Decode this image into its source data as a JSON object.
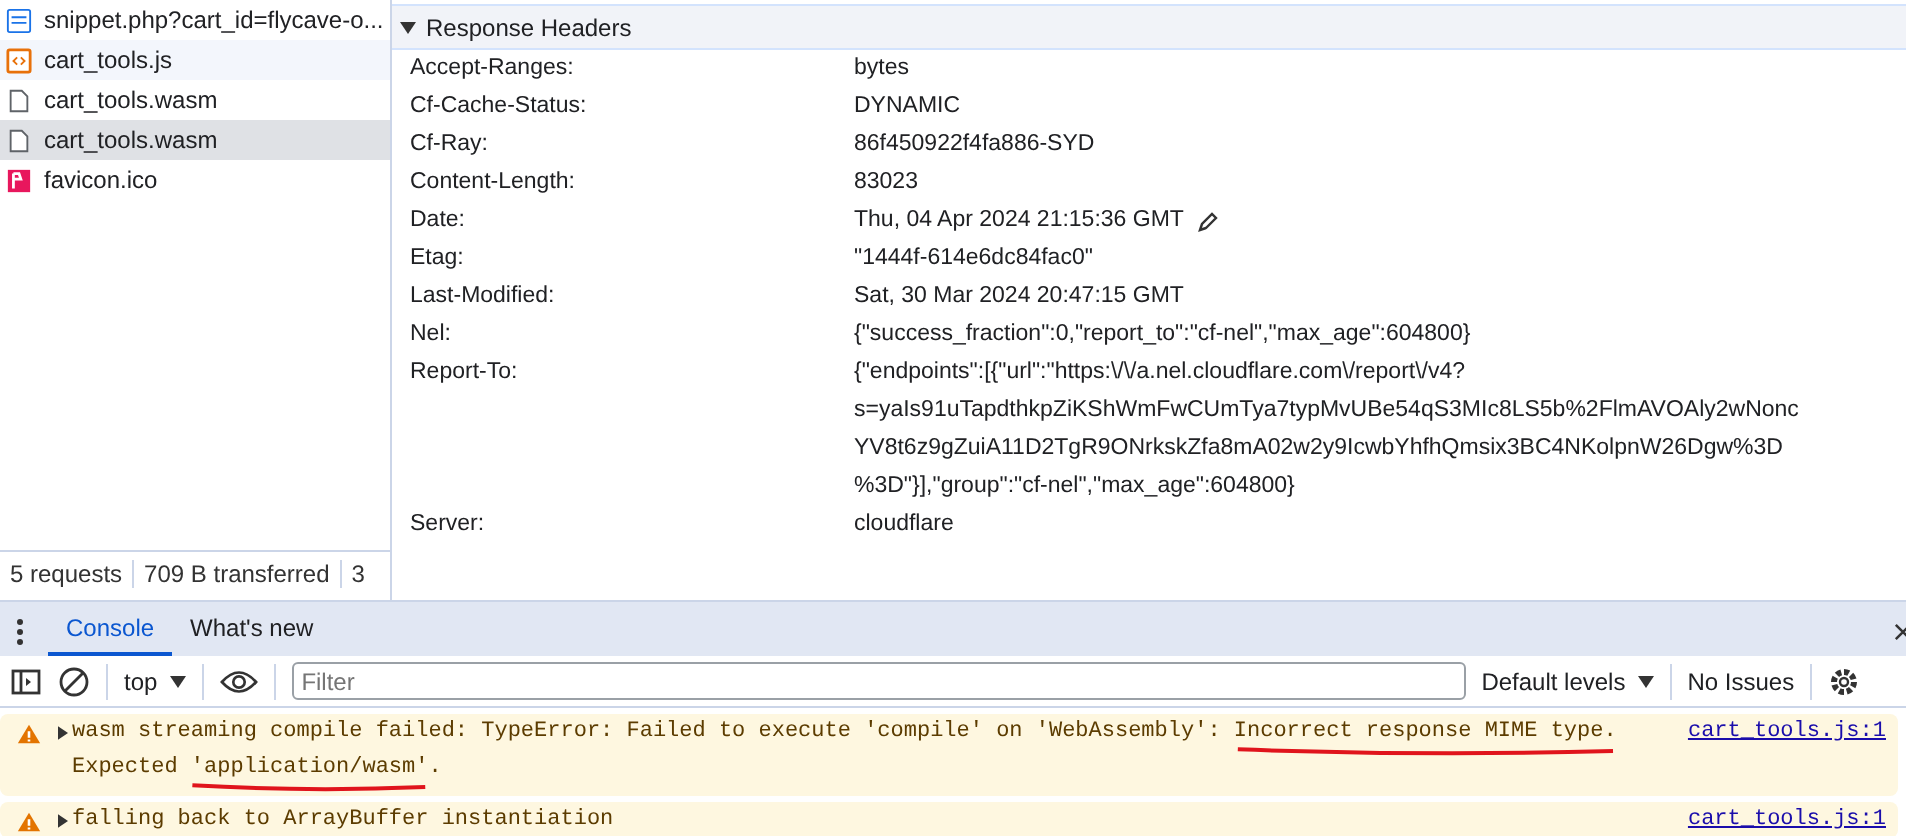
{
  "requests": [
    {
      "name": "snippet.php?cart_id=flycave-o...",
      "kind": "doc",
      "selected": false
    },
    {
      "name": "cart_tools.js",
      "kind": "script",
      "selected": false
    },
    {
      "name": "cart_tools.wasm",
      "kind": "file",
      "selected": false
    },
    {
      "name": "cart_tools.wasm",
      "kind": "file",
      "selected": true
    },
    {
      "name": "favicon.ico",
      "kind": "image",
      "selected": false
    }
  ],
  "status_bar": [
    "5 requests",
    "709 B transferred",
    "3"
  ],
  "response_headers": {
    "title": "Response Headers",
    "expanded": true,
    "rows": [
      {
        "name": "Accept-Ranges:",
        "value": "bytes"
      },
      {
        "name": "Cf-Cache-Status:",
        "value": "DYNAMIC"
      },
      {
        "name": "Cf-Ray:",
        "value": "86f450922f4fa886-SYD"
      },
      {
        "name": "Content-Length:",
        "value": "83023"
      },
      {
        "name": "Date:",
        "value": "Thu, 04 Apr 2024 21:15:36 GMT",
        "editable": true
      },
      {
        "name": "Etag:",
        "value": "\"1444f-614e6dc84fac0\""
      },
      {
        "name": "Last-Modified:",
        "value": "Sat, 30 Mar 2024 20:47:15 GMT"
      },
      {
        "name": "Nel:",
        "value": "{\"success_fraction\":0,\"report_to\":\"cf-nel\",\"max_age\":604800}"
      },
      {
        "name": "Report-To:",
        "value": "{\"endpoints\":[{\"url\":\"https:\\/\\/a.nel.cloudflare.com\\/report\\/v4?\ns=yaIs91uTapdthkpZiKShWmFwCUmTya7typMvUBe54qS3MIc8LS5b%2FlmAVOAly2wNonc\nYV8t6z9gZuiA11D2TgR9ONrkskZfa8mA02w2y9IcwbYhfhQmsix3BC4NKolpnW26Dgw%3D\n%3D\"}],\"group\":\"cf-nel\",\"max_age\":604800}"
      },
      {
        "name": "Server:",
        "value": "cloudflare"
      }
    ]
  },
  "drawer_tabs": [
    {
      "label": "Console",
      "selected": true
    },
    {
      "label": "What's new",
      "selected": false
    }
  ],
  "console_toolbar": {
    "context": "top",
    "filter_placeholder": "Filter",
    "levels": "Default levels",
    "issues": "No Issues"
  },
  "messages": [
    {
      "kind": "warning",
      "lines": [
        "wasm streaming compile failed: TypeError: Failed to execute 'compile' on 'WebAssembly': Incorrect response MIME type.",
        "Expected 'application/wasm'."
      ],
      "source": "cart_tools.js:1",
      "annotated": true
    },
    {
      "kind": "warning",
      "lines": [
        "falling back to ArrayBuffer instantiation"
      ],
      "source": "cart_tools.js:1",
      "annotated": false
    }
  ]
}
